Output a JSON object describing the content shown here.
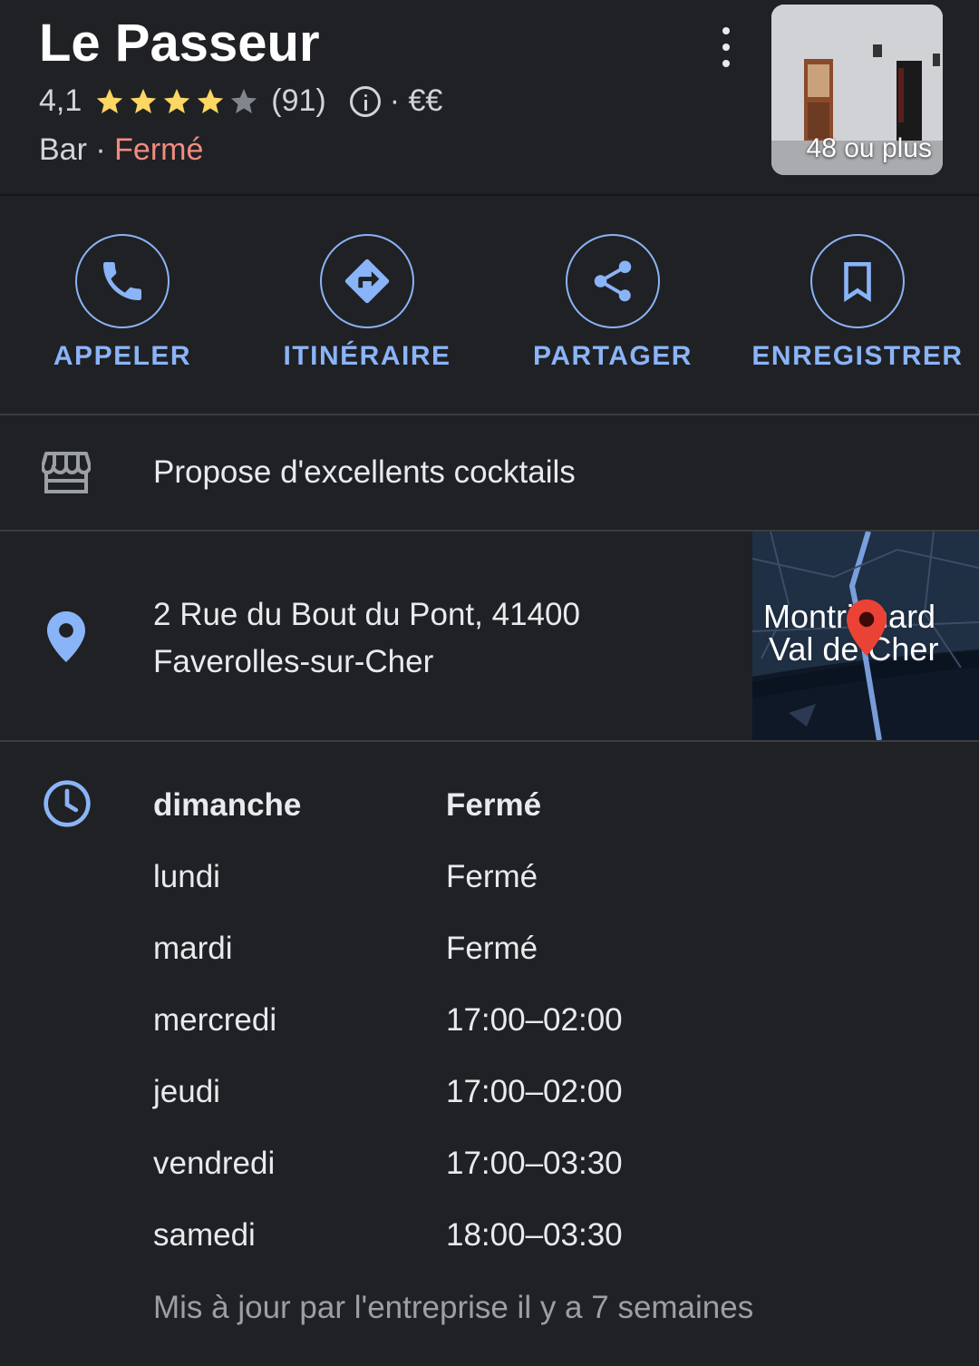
{
  "header": {
    "title": "Le Passeur",
    "rating": "4,1",
    "rating_stars": 4.1,
    "review_count": "(91)",
    "price_level": "· €€",
    "category": "Bar",
    "separator": " · ",
    "status": "Fermé",
    "photo_count": "48 ou plus"
  },
  "actions": [
    {
      "label": "APPELER",
      "icon": "phone-icon"
    },
    {
      "label": "ITINÉRAIRE",
      "icon": "directions-icon"
    },
    {
      "label": "PARTAGER",
      "icon": "share-icon"
    },
    {
      "label": "ENREGISTRER",
      "icon": "bookmark-icon"
    }
  ],
  "highlight": {
    "text": "Propose d'excellents cocktails",
    "icon": "storefront-icon"
  },
  "address": {
    "line1": "2 Rue du Bout du Pont, 41400",
    "line2": "Faverolles-sur-Cher",
    "icon": "location-pin-icon",
    "map_label_1": "Montrichard",
    "map_label_2": "Val de Cher"
  },
  "hours": {
    "icon": "clock-icon",
    "rows": [
      {
        "day": "dimanche",
        "time": "Fermé"
      },
      {
        "day": "lundi",
        "time": "Fermé"
      },
      {
        "day": "mardi",
        "time": "Fermé"
      },
      {
        "day": "mercredi",
        "time": "17:00–02:00"
      },
      {
        "day": "jeudi",
        "time": "17:00–02:00"
      },
      {
        "day": "vendredi",
        "time": "17:00–03:30"
      },
      {
        "day": "samedi",
        "time": "18:00–03:30"
      }
    ],
    "updated": "Mis à jour par l'entreprise il y a 7 semaines"
  },
  "colors": {
    "background": "#202124",
    "accent": "#8ab4f8",
    "star": "#fdd663",
    "closed": "#f28b82",
    "map_pin": "#ea4335"
  }
}
